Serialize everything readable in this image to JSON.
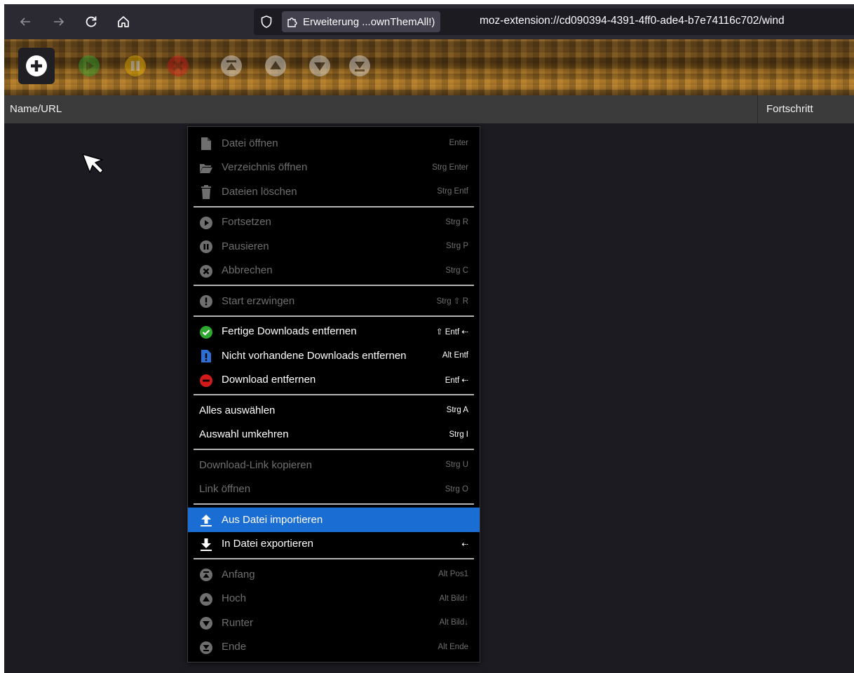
{
  "browser": {
    "back_icon": "arrow-left-icon",
    "forward_icon": "arrow-right-icon",
    "reload_icon": "reload-icon",
    "home_icon": "home-icon",
    "identity_label": "Erweiterung ...ownThemAll!)",
    "url": "moz-extension://cd090394-4391-4ff0-ade4-b7e74116c702/wind"
  },
  "toolbar": {
    "buttons": [
      "add-icon",
      "resume-icon",
      "pause-icon",
      "cancel-icon",
      "top-icon",
      "up-icon",
      "down-icon",
      "bottom-icon"
    ]
  },
  "columns": {
    "name": "Name/URL",
    "progress": "Fortschritt"
  },
  "menu": {
    "open_file": {
      "label": "Datei öffnen",
      "shortcut": "Enter"
    },
    "open_dir": {
      "label": "Verzeichnis öffnen",
      "shortcut": "Strg Enter"
    },
    "delete_files": {
      "label": "Dateien löschen",
      "shortcut": "Strg Entf"
    },
    "resume": {
      "label": "Fortsetzen",
      "shortcut": "Strg R"
    },
    "pause": {
      "label": "Pausieren",
      "shortcut": "Strg P"
    },
    "cancel": {
      "label": "Abbrechen",
      "shortcut": "Strg C"
    },
    "force_start": {
      "label": "Start erzwingen",
      "shortcut": "Strg ⇧ R"
    },
    "remove_finished": {
      "label": "Fertige Downloads entfernen",
      "shortcut": "⇧ Entf  ⇠"
    },
    "remove_missing": {
      "label": "Nicht vorhandene Downloads entfernen",
      "shortcut": "Alt Entf"
    },
    "remove_download": {
      "label": "Download entfernen",
      "shortcut": "Entf  ⇠"
    },
    "select_all": {
      "label": "Alles auswählen",
      "shortcut": "Strg A"
    },
    "invert_selection": {
      "label": "Auswahl umkehren",
      "shortcut": "Strg I"
    },
    "copy_link": {
      "label": "Download-Link kopieren",
      "shortcut": "Strg U"
    },
    "open_link": {
      "label": "Link öffnen",
      "shortcut": "Strg O"
    },
    "import": {
      "label": "Aus Datei importieren",
      "shortcut": ""
    },
    "export": {
      "label": "In Datei exportieren",
      "shortcut": "⇠"
    },
    "move_top": {
      "label": "Anfang",
      "shortcut": "Alt Pos1"
    },
    "move_up": {
      "label": "Hoch",
      "shortcut": "Alt Bild↑"
    },
    "move_down": {
      "label": "Runter",
      "shortcut": "Alt Bild↓"
    },
    "move_bottom": {
      "label": "Ende",
      "shortcut": "Alt Ende"
    }
  },
  "colors": {
    "highlight": "#1a6dd2",
    "menu_bg": "#000000",
    "disabled_text": "#6f6f6f"
  }
}
